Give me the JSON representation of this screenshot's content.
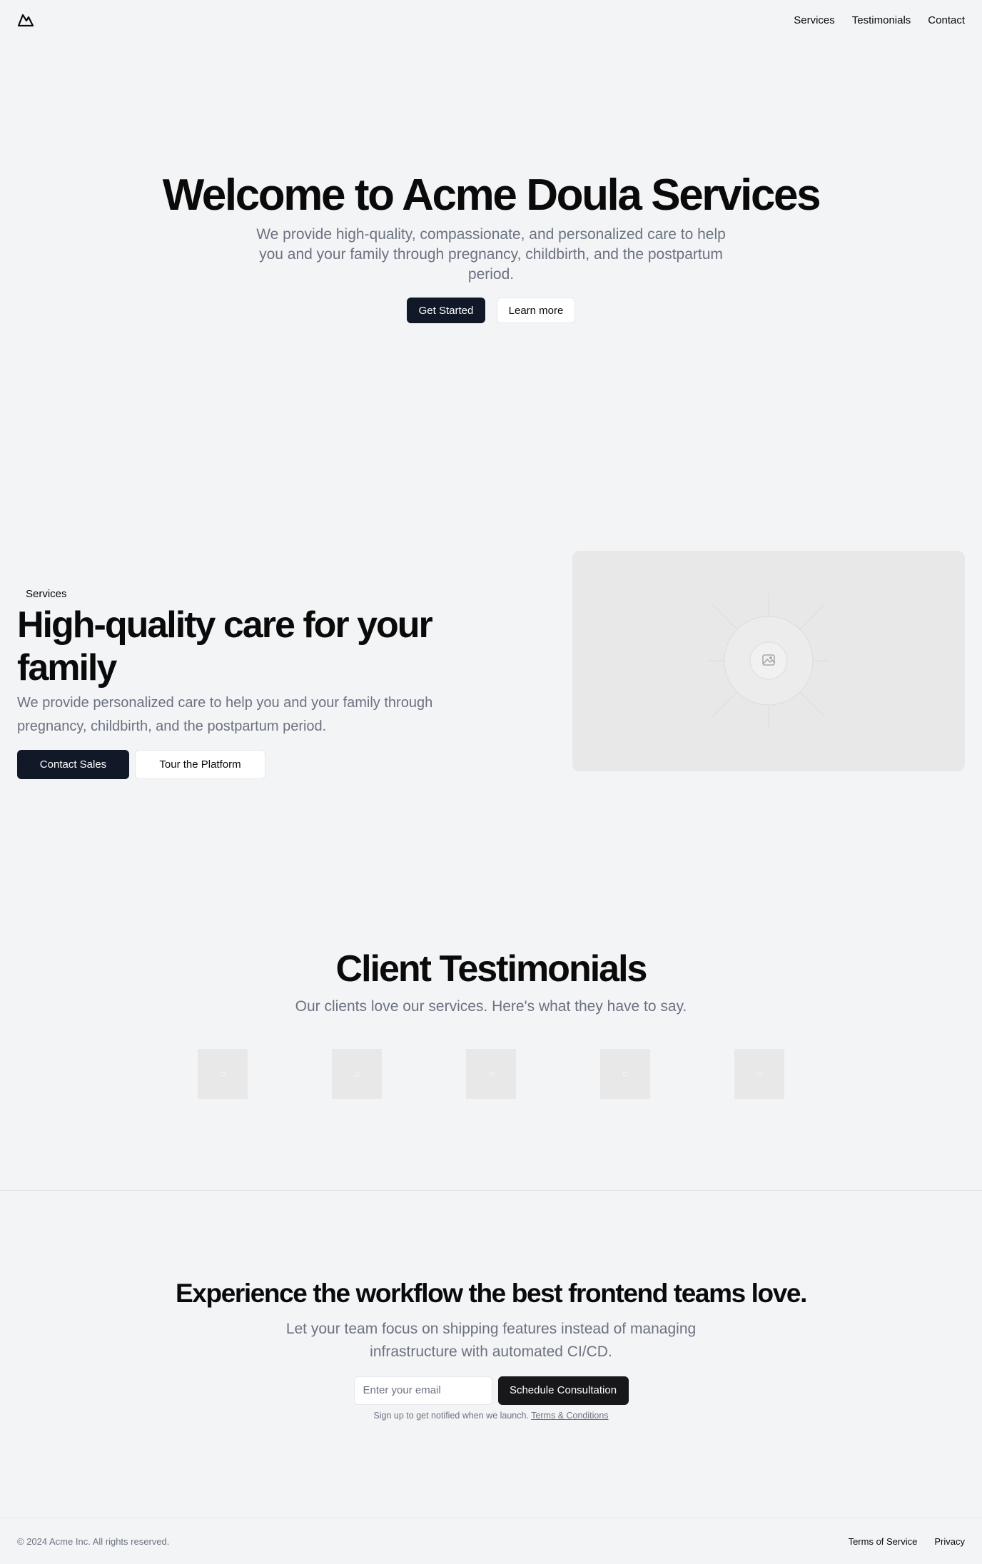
{
  "header": {
    "logo_icon": "mountain-icon",
    "nav": [
      "Services",
      "Testimonials",
      "Contact"
    ]
  },
  "hero": {
    "title": "Welcome to Acme Doula Services",
    "subtitle": "We provide high-quality, compassionate, and personalized care to help you and your family through pregnancy, childbirth, and the postpartum period.",
    "primary_label": "Get Started",
    "secondary_label": "Learn more"
  },
  "services": {
    "badge": "Services",
    "title": "High-quality care for your family",
    "description": "We provide personalized care to help you and your family through pregnancy, childbirth, and the postpartum period.",
    "primary_label": "Contact Sales",
    "secondary_label": "Tour the Platform",
    "image_icon": "image-placeholder-icon"
  },
  "testimonials": {
    "title": "Client Testimonials",
    "subtitle": "Our clients love our services. Here's what they have to say."
  },
  "cta": {
    "title": "Experience the workflow the best frontend teams love.",
    "subtitle": "Let your team focus on shipping features instead of managing infrastructure with automated CI/CD.",
    "email_placeholder": "Enter your email",
    "button_label": "Schedule Consultation",
    "note": "Sign up to get notified when we launch.",
    "terms_label": "Terms & Conditions"
  },
  "footer": {
    "copyright": "© 2024 Acme Inc. All rights reserved.",
    "links": [
      "Terms of Service",
      "Privacy"
    ]
  },
  "colors": {
    "background": "#f3f4f6",
    "primary_button": "#111827",
    "muted_text": "#6b7280",
    "placeholder": "#e8e8e8"
  }
}
